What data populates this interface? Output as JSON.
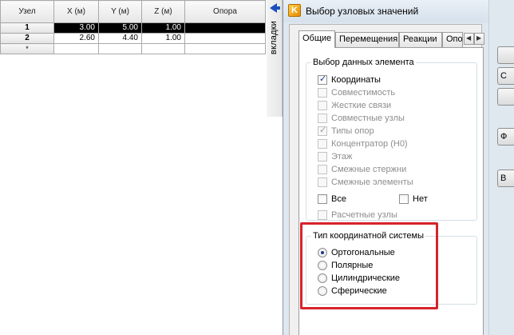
{
  "grid": {
    "headers": [
      "Узел",
      "X (м)",
      "Y (м)",
      "Z (м)",
      "Опора"
    ],
    "rows": [
      {
        "id": "1",
        "x": "3.00",
        "y": "5.00",
        "z": "1.00",
        "support": ""
      },
      {
        "id": "2",
        "x": "2.60",
        "y": "4.40",
        "z": "1.00",
        "support": ""
      }
    ],
    "new_row_marker": "*"
  },
  "side_strip": {
    "label": "вкладки",
    "arrow_icon": "arrow-left-icon"
  },
  "dialog": {
    "title": "Выбор узловых значений",
    "tabs": [
      "Общие",
      "Перемещения",
      "Реакции",
      "Опо"
    ],
    "active_tab": "Общие",
    "element_group": {
      "title": "Выбор данных элемента",
      "items": [
        {
          "label": "Координаты",
          "checked": true,
          "enabled": true
        },
        {
          "label": "Совместимость",
          "checked": false,
          "enabled": false
        },
        {
          "label": "Жесткие связи",
          "checked": false,
          "enabled": false
        },
        {
          "label": "Совместные узлы",
          "checked": false,
          "enabled": false
        },
        {
          "label": "Типы опор",
          "checked": true,
          "enabled": false
        },
        {
          "label": "Концентратор (Н0)",
          "checked": false,
          "enabled": false
        },
        {
          "label": "Этаж",
          "checked": false,
          "enabled": false
        },
        {
          "label": "Смежные стержни",
          "checked": false,
          "enabled": false
        },
        {
          "label": "Смежные элементы",
          "checked": false,
          "enabled": false
        }
      ],
      "all_label": "Все",
      "none_label": "Нет",
      "calc_nodes_label": "Расчетные узлы"
    },
    "coord_group": {
      "title": "Тип координатной системы",
      "options": [
        "Ортогональные",
        "Полярные",
        "Цилиндрические",
        "Сферические"
      ],
      "selected": "Ортогональные"
    }
  },
  "right_buttons": [
    "",
    "С",
    "",
    "Ф",
    "В"
  ],
  "colors": {
    "highlight": "#d6232c",
    "dialog_bg": "#dfe7ef",
    "selected_row": "#000000",
    "accent_check": "#1d3b85"
  }
}
